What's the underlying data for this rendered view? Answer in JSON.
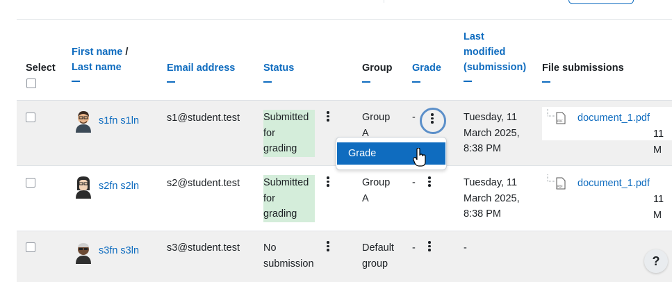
{
  "header": {
    "select": "Select",
    "first_name": "First name",
    "name_sep": " /",
    "last_name": "Last name",
    "email": "Email address",
    "status": "Status",
    "group": "Group",
    "grade": "Grade",
    "last_modified_1": "Last",
    "last_modified_2": "modified",
    "last_modified_3": "(submission)",
    "file_submissions": "File submissions"
  },
  "rows": [
    {
      "name": "s1fn s1ln",
      "email": "s1@student.test",
      "status": [
        "Submitted",
        "for",
        "grading"
      ],
      "group": [
        "Group",
        "A"
      ],
      "grade": "-",
      "modified": [
        "Tuesday, 11",
        "March 2025,",
        "8:38 PM"
      ],
      "file": "document_1.pdf",
      "file_extra": "11 M"
    },
    {
      "name": "s2fn s2ln",
      "email": "s2@student.test",
      "status": [
        "Submitted",
        "for",
        "grading"
      ],
      "group": [
        "Group",
        "A"
      ],
      "grade": "-",
      "modified": [
        "Tuesday, 11",
        "March 2025,",
        "8:38 PM"
      ],
      "file": "document_1.pdf",
      "file_extra": "11 M"
    },
    {
      "name": "s3fn s3ln",
      "email": "s3@student.test",
      "status": [
        "No",
        "submission"
      ],
      "group": [
        "Default",
        "group"
      ],
      "grade": "-",
      "modified": [
        "-"
      ]
    }
  ],
  "dropdown": {
    "item": "Grade"
  },
  "help": "?",
  "colors": {
    "link": "#0f6cbf",
    "submitted_bg": "#d4edda",
    "row_highlight": "#f0f0f0"
  }
}
